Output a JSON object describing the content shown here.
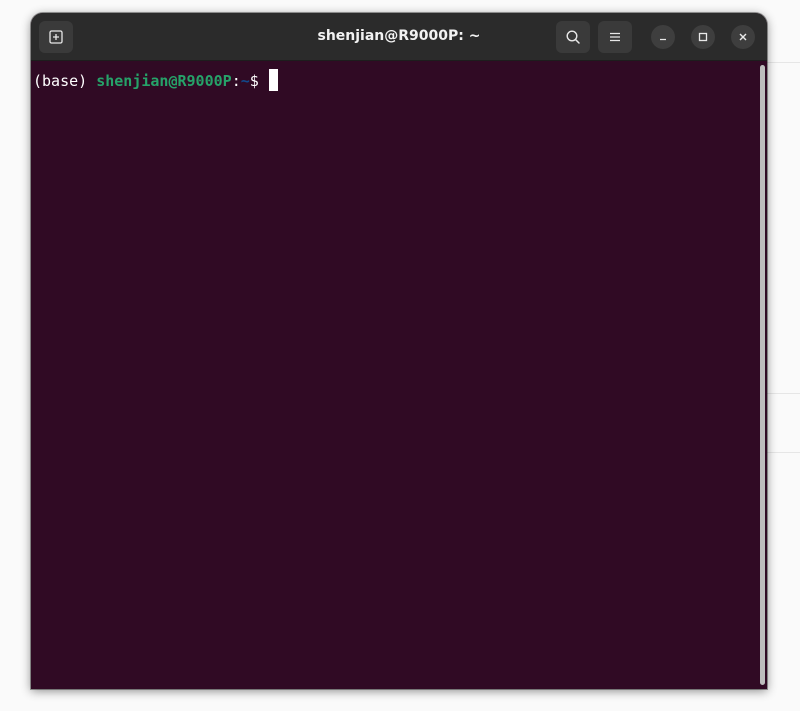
{
  "window": {
    "title": "shenjian@R9000P: ~"
  },
  "toolbar": {
    "new_tab_icon": "new-tab-icon",
    "search_icon": "search-icon",
    "menu_icon": "hamburger-menu-icon",
    "minimize_icon": "minimize-icon",
    "maximize_icon": "maximize-icon",
    "close_icon": "close-icon"
  },
  "terminal": {
    "prompt": {
      "env": "(base) ",
      "user_host": "shenjian@R9000P",
      "colon": ":",
      "path": "~",
      "dollar": "$ "
    }
  },
  "colors": {
    "terminal_bg": "#300a24",
    "titlebar_bg": "#2b2b2b",
    "user_host": "#26a269",
    "path": "#12488b",
    "text": "#ffffff"
  }
}
